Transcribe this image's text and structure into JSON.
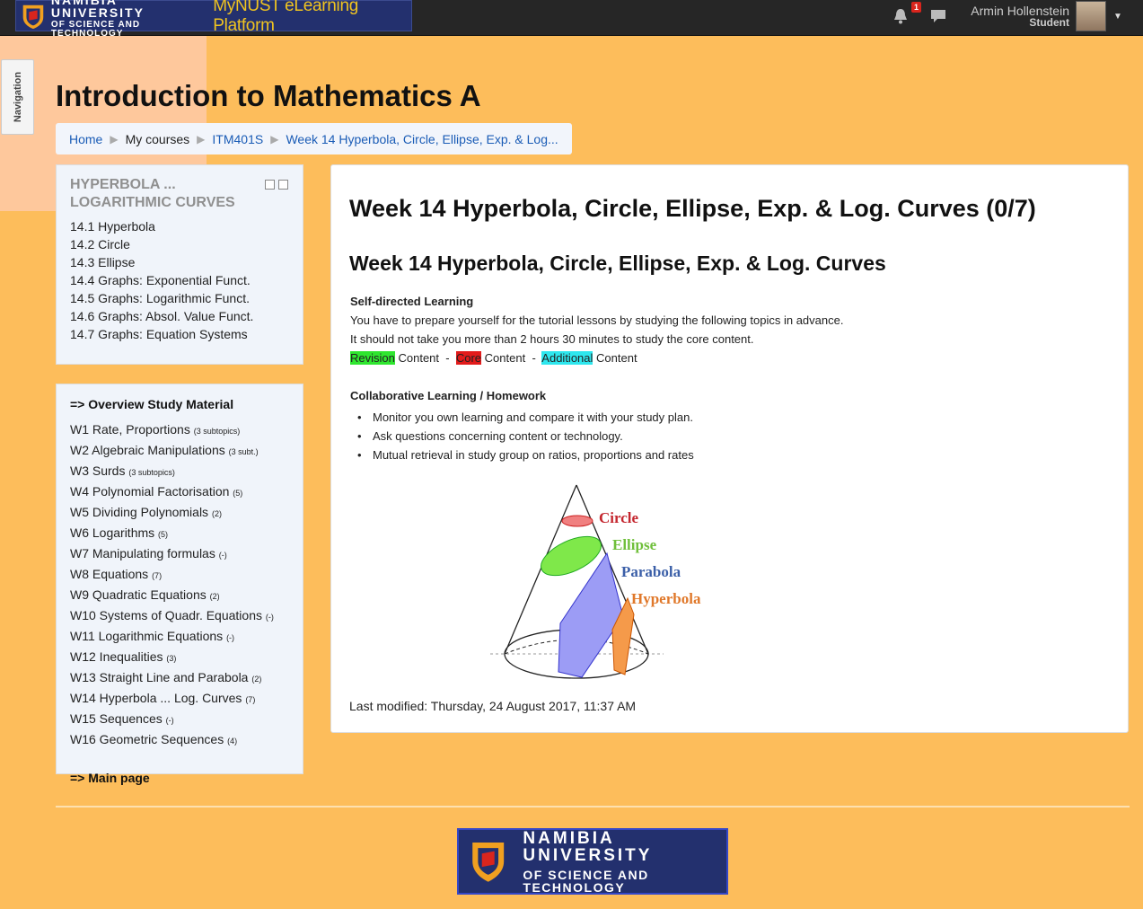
{
  "topbar": {
    "university_line1": "NAMIBIA UNIVERSITY",
    "university_line2": "OF SCIENCE AND TECHNOLOGY",
    "platform": "MyNUST eLearning Platform",
    "notification_count": "1",
    "user_name": "Armin Hollenstein",
    "user_role": "Student"
  },
  "nav_tab": "Navigation",
  "page_title": "Introduction to Mathematics A",
  "breadcrumb": {
    "home": "Home",
    "my_courses": "My courses",
    "course": "ITM401S",
    "current": "Week 14 Hyperbola, Circle, Ellipse, Exp. & Log..."
  },
  "week_block": {
    "title": "HYPERBOLA ... LOGARITHMIC CURVES",
    "items": [
      "14.1 Hyperbola",
      "14.2 Circle",
      "14.3 Ellipse",
      "14.4 Graphs: Exponential Funct.",
      "14.5 Graphs: Logarithmic Funct.",
      "14.6 Graphs: Absol. Value Funct.",
      "14.7 Graphs: Equation Systems"
    ]
  },
  "overview_block": {
    "heading": "=> Overview Study Material",
    "items": [
      {
        "label": "W1 Rate, Proportions",
        "note": "(3 subtopics)"
      },
      {
        "label": "W2 Algebraic Manipulations",
        "note": "(3 subt.)"
      },
      {
        "label": "W3 Surds",
        "note": "(3 subtopics)"
      },
      {
        "label": "W4 Polynomial Factorisation",
        "note": "(5)"
      },
      {
        "label": "W5 Dividing Polynomials",
        "note": "(2)"
      },
      {
        "label": "W6 Logarithms",
        "note": "(5)"
      },
      {
        "label": "W7 Manipulating formulas",
        "note": "(-)"
      },
      {
        "label": "W8 Equations",
        "note": "(7)"
      },
      {
        "label": "W9 Quadratic Equations",
        "note": "(2)"
      },
      {
        "label": "W10 Systems of Quadr. Equations",
        "note": "(-)"
      },
      {
        "label": "W11 Logarithmic Equations",
        "note": "(-)"
      },
      {
        "label": "W12 Inequalities",
        "note": "(3)"
      },
      {
        "label": "W13 Straight Line and Parabola",
        "note": "(2)"
      },
      {
        "label": "W14 Hyperbola ... Log. Curves",
        "note": "(7)"
      },
      {
        "label": "W15 Sequences",
        "note": "(-)"
      },
      {
        "label": "W16 Geometric Sequences",
        "note": "(4)"
      }
    ],
    "main_page": "=> Main page"
  },
  "main": {
    "title": "Week 14 Hyperbola, Circle, Ellipse, Exp. & Log. Curves (0/7)",
    "subtitle": "Week 14 Hyperbola, Circle, Ellipse, Exp. & Log. Curves",
    "self_heading": "Self-directed Learning",
    "self_line1": "You have to prepare yourself for the tutorial lessons by studying the following topics in advance.",
    "self_line2": "It should not take you more than 2 hours 30 minutes  to study the core content.",
    "legend": {
      "revision": "Revision",
      "core": "Core",
      "additional": "Additional",
      "content": "Content",
      "dash": "-"
    },
    "collab_heading": "Collaborative Learning / Homework",
    "collab_items": [
      "Monitor you own learning and compare it with your study plan.",
      "Ask questions concerning content or technology.",
      "Mutual retrieval in study group on ratios, proportions and rates"
    ],
    "diagram_labels": {
      "circle": "Circle",
      "ellipse": "Ellipse",
      "parabola": "Parabola",
      "hyperbola": "Hyperbola"
    },
    "last_modified": "Last modified: Thursday, 24 August 2017, 11:37 AM"
  },
  "colors": {
    "background": "#fdbd5b",
    "circle": "#f08080",
    "ellipse": "#7fe84a",
    "parabola": "#9c9cf5",
    "hyperbola": "#f59a4a"
  }
}
